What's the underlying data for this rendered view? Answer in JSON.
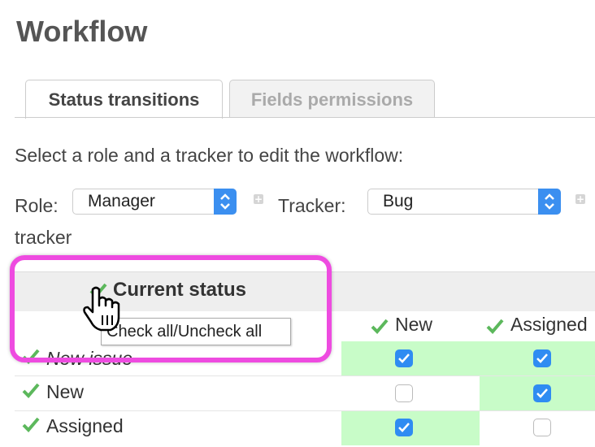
{
  "page": {
    "title": "Workflow"
  },
  "tabs": [
    {
      "label": "Status transitions",
      "active": true
    },
    {
      "label": "Fields permissions",
      "active": false
    }
  ],
  "instructions": "Select a role and a tracker to edit the workflow:",
  "role": {
    "label": "Role:",
    "value": "Manager"
  },
  "tracker": {
    "label": "Tracker:",
    "value": "Bug"
  },
  "tracker_extra": "tracker",
  "table": {
    "current_status_header": "Current status",
    "tooltip": "Check all/Uncheck all",
    "columns": [
      "New",
      "Assigned"
    ],
    "rows": [
      {
        "label": "New issue",
        "checks": [
          true,
          true
        ]
      },
      {
        "label": "New",
        "checks": [
          false,
          true
        ]
      },
      {
        "label": "Assigned",
        "checks": [
          true,
          false
        ]
      }
    ]
  },
  "colors": {
    "accent": "#2f8cf2",
    "allowed_cell": "#c8fcc8",
    "highlight": "#ee4be0",
    "check": "#5cb85c"
  },
  "icons": [
    "check-icon",
    "select-arrows-icon",
    "plus-icon",
    "hand-cursor-icon"
  ]
}
